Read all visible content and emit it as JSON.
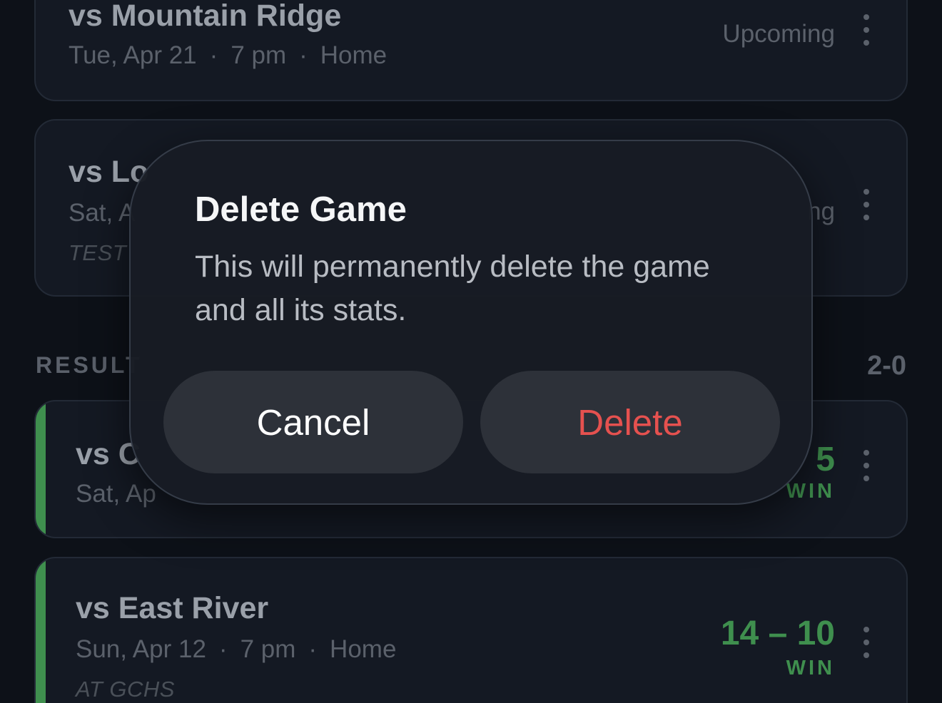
{
  "games_upcoming": [
    {
      "title": "vs Mountain Ridge",
      "date": "Tue, Apr 21",
      "time": "7 pm",
      "location": "Home",
      "status": "Upcoming"
    },
    {
      "title": "vs Lo",
      "date": "Sat, A",
      "note": "TEST",
      "status": "ng"
    }
  ],
  "results_section": {
    "label": "RESULT",
    "record": "2-0"
  },
  "games_results": [
    {
      "title": "vs C",
      "date": "Sat, Ap",
      "score": "5",
      "outcome": "WIN"
    },
    {
      "title": "vs East River",
      "date": "Sun, Apr 12",
      "time": "7 pm",
      "location": "Home",
      "note": "AT GCHS",
      "score": "14 – 10",
      "outcome": "WIN"
    }
  ],
  "dialog": {
    "title": "Delete Game",
    "message": "This will permanently delete the game and all its stats.",
    "cancel_label": "Cancel",
    "delete_label": "Delete"
  },
  "colors": {
    "win": "#3f8f4e",
    "destructive": "#e5514f",
    "background": "#0d1118",
    "card": "#141923"
  },
  "icons": {
    "more": "more-vertical-icon"
  }
}
